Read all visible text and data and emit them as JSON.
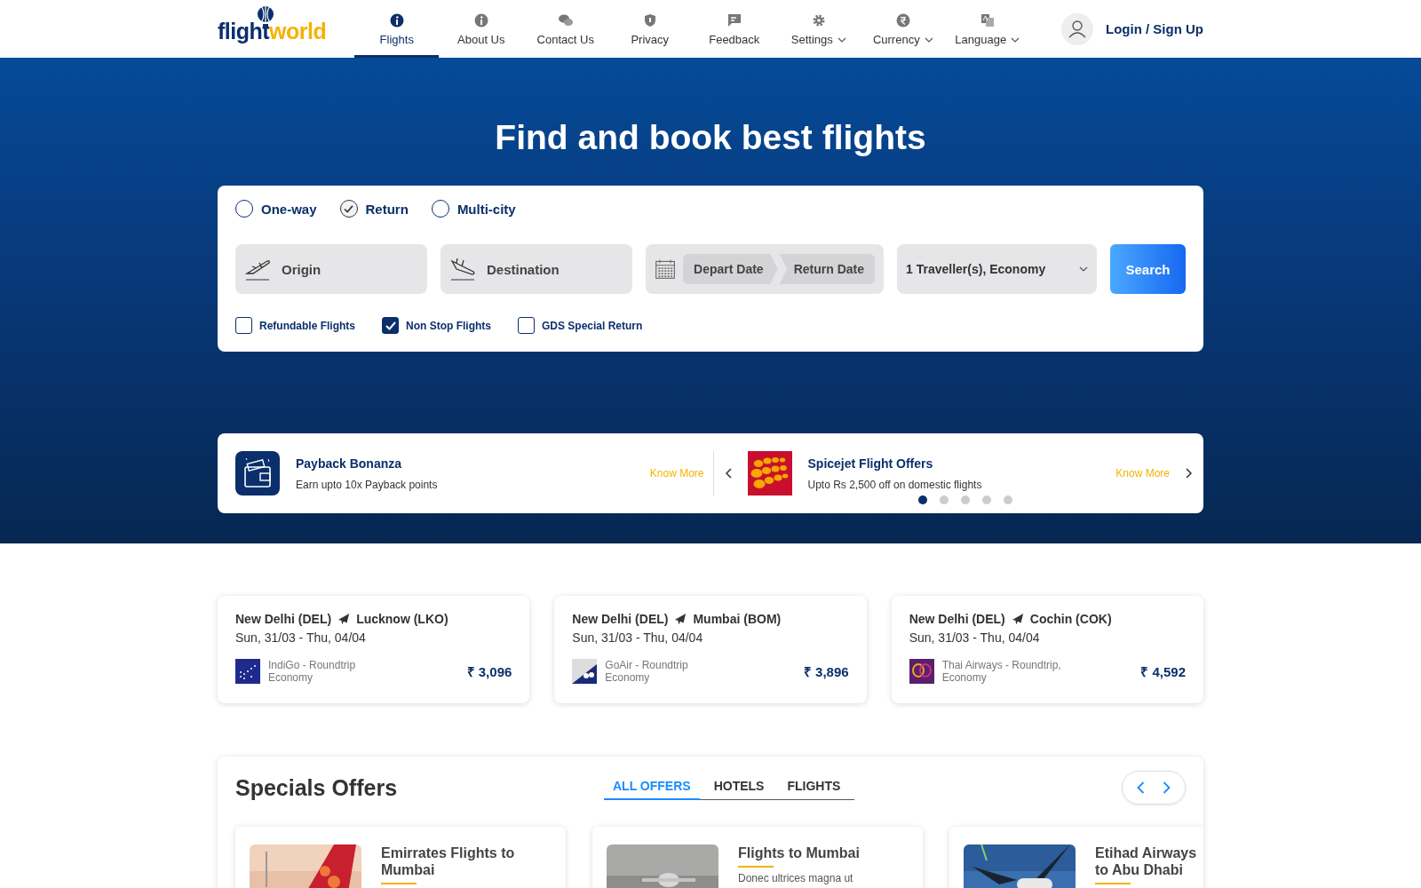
{
  "header": {
    "logo": {
      "part1": "flight",
      "part2": "world"
    },
    "nav": [
      {
        "label": "Flights",
        "kind": "info",
        "selected": true,
        "dropdown": false
      },
      {
        "label": "About Us",
        "kind": "info",
        "selected": false,
        "dropdown": false
      },
      {
        "label": "Contact Us",
        "kind": "chat",
        "selected": false,
        "dropdown": false
      },
      {
        "label": "Privacy",
        "kind": "shield",
        "selected": false,
        "dropdown": false
      },
      {
        "label": "Feedback",
        "kind": "feedback",
        "selected": false,
        "dropdown": false
      },
      {
        "label": "Settings",
        "kind": "gear",
        "selected": false,
        "dropdown": true
      },
      {
        "label": "Currency",
        "kind": "rupee",
        "selected": false,
        "dropdown": true
      },
      {
        "label": "Language",
        "kind": "translate",
        "selected": false,
        "dropdown": true
      }
    ],
    "login": "Login / Sign Up"
  },
  "hero": {
    "title": "Find and book best flights"
  },
  "search": {
    "trip_types": [
      {
        "label": "One-way",
        "selected": false
      },
      {
        "label": "Return",
        "selected": true
      },
      {
        "label": "Multi-city",
        "selected": false
      }
    ],
    "origin": {
      "placeholder": "Origin"
    },
    "destination": {
      "placeholder": "Destination"
    },
    "depart": {
      "placeholder": "Depart Date"
    },
    "return": {
      "placeholder": "Return Date"
    },
    "travellers": {
      "value": "1 Traveller(s), Economy"
    },
    "button": "Search",
    "filters": [
      {
        "label": "Refundable Flights",
        "checked": false
      },
      {
        "label": "Non Stop Flights",
        "checked": true
      },
      {
        "label": "GDS Special Return",
        "checked": false
      }
    ]
  },
  "promos": {
    "items": [
      {
        "kind": "wallet",
        "title": "Payback Bonanza",
        "text": "Earn upto 10x Payback points",
        "link": "Know More"
      },
      {
        "kind": "spicejet",
        "title": "Spicejet Flight Offers",
        "text": "Upto Rs 2,500 off on domestic flights",
        "link": "Know More"
      }
    ],
    "dots": [
      {
        "selected": true
      },
      {
        "selected": false
      },
      {
        "selected": false
      },
      {
        "selected": false
      },
      {
        "selected": false
      }
    ]
  },
  "routes": [
    {
      "from": "New Delhi (DEL)",
      "to": "Lucknow (LKO)",
      "dates": "Sun, 31/03 - Thu, 04/04",
      "airline": "IndiGo - Roundtrip",
      "cabin": "Economy",
      "price": "₹ 3,096",
      "kind": "indigo"
    },
    {
      "from": "New Delhi (DEL)",
      "to": "Mumbai (BOM)",
      "dates": "Sun, 31/03 - Thu, 04/04",
      "airline": "GoAir - Roundtrip",
      "cabin": "Economy",
      "price": "₹ 3,896",
      "kind": "goair"
    },
    {
      "from": "New Delhi (DEL)",
      "to": "Cochin (COK)",
      "dates": "Sun, 31/03 - Thu, 04/04",
      "airline": "Thai Airways - Roundtrip,",
      "cabin": "Economy",
      "price": "₹ 4,592",
      "kind": "thai"
    }
  ],
  "specials": {
    "title": "Specials Offers",
    "tabs": [
      {
        "label": "ALL OFFERS",
        "selected": true
      },
      {
        "label": "HOTELS",
        "selected": false
      },
      {
        "label": "FLIGHTS",
        "selected": false
      }
    ],
    "offers": [
      {
        "title": "Emirrates Flights to Mumbai",
        "kind": "tail"
      },
      {
        "title": "Flights to Mumbai",
        "text": "Donec ultrices magna ut",
        "kind": "grey"
      },
      {
        "title": "Etihad Airways to Abu Dhabi",
        "kind": "sky"
      }
    ]
  }
}
